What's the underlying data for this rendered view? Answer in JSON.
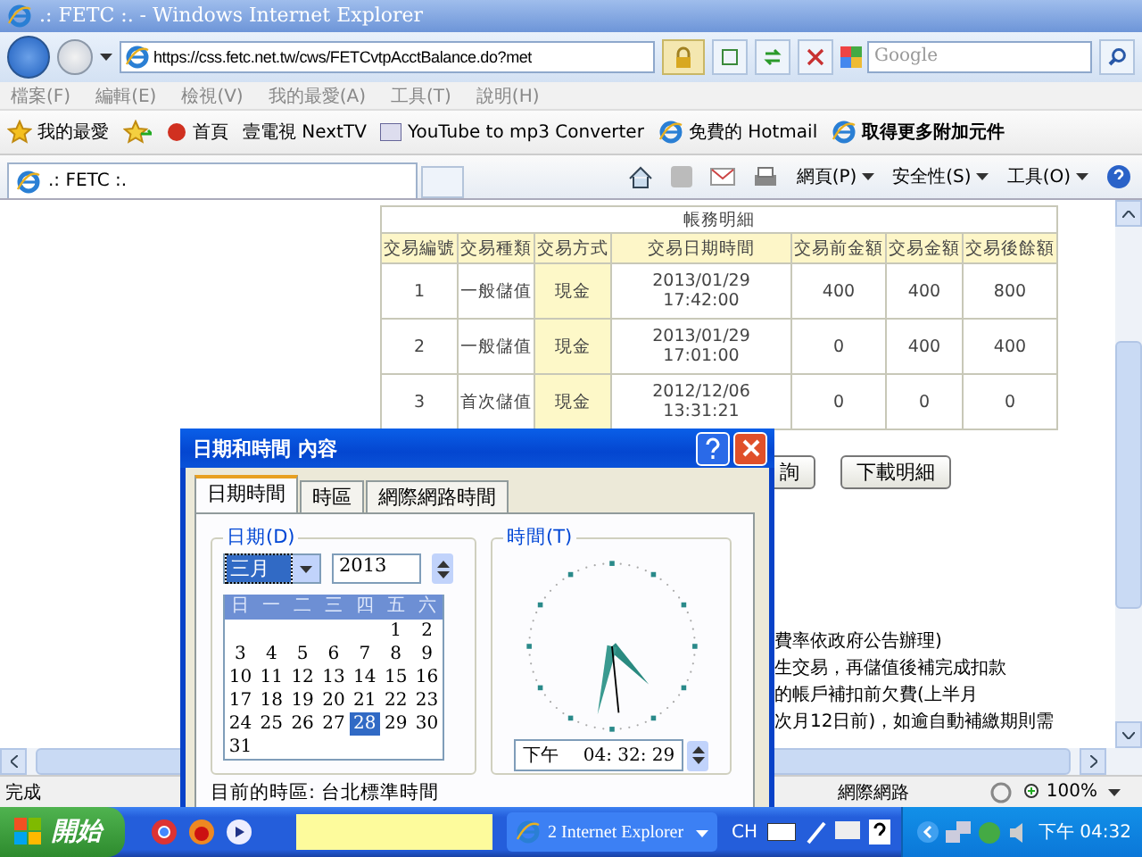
{
  "window": {
    "title": ".: FETC :. - Windows Internet Explorer"
  },
  "address_bar": {
    "url": "https://css.fetc.net.tw/cws/FETCvtpAcctBalance.do?met",
    "search_placeholder": "Google"
  },
  "menu": [
    "檔案(F)",
    "編輯(E)",
    "檢視(V)",
    "我的最愛(A)",
    "工具(T)",
    "說明(H)"
  ],
  "favorites": {
    "label": "我的最愛",
    "links": [
      "首頁",
      "壹電視 NextTV",
      "YouTube to mp3 Converter",
      "免費的 Hotmail",
      "取得更多附加元件"
    ]
  },
  "tabs": [
    {
      "label": ".: FETC :.",
      "selected": true
    }
  ],
  "command_bar": [
    "網頁(P)",
    "安全性(S)",
    "工具(O)"
  ],
  "page": {
    "table": {
      "caption": "帳務明細",
      "columns": [
        {
          "label": "交易編號",
          "highlight": false
        },
        {
          "label": "交易種類",
          "highlight": false
        },
        {
          "label": "交易方式",
          "highlight": true
        },
        {
          "label": "交易日期時間",
          "highlight": false
        },
        {
          "label": "交易前金額",
          "highlight": false
        },
        {
          "label": "交易金額",
          "highlight": false
        },
        {
          "label": "交易後餘額",
          "highlight": false
        }
      ],
      "rows": [
        [
          "1",
          "一般儲值",
          "現金",
          "2013/01/29 17:42:00",
          "400",
          "400",
          "800"
        ],
        [
          "2",
          "一般儲值",
          "現金",
          "2013/01/29 17:01:00",
          "0",
          "400",
          "400"
        ],
        [
          "3",
          "首次儲值",
          "現金",
          "2012/12/06 13:31:21",
          "0",
          "0",
          "0"
        ]
      ]
    },
    "buttons": [
      "詢",
      "下載明細"
    ],
    "notes": [
      "費率依政府公告辦理)",
      "生交易，再儲值後補完成扣款",
      "的帳戶補扣前欠費(上半月",
      "次月12日前)，如逾自動補繳期則需"
    ]
  },
  "status_bar": {
    "text": "完成",
    "zone": "網際網路",
    "zoom": "100%"
  },
  "dialog": {
    "title": "日期和時間 內容",
    "tabs": [
      {
        "label": "日期時間",
        "selected": true
      },
      {
        "label": "時區",
        "selected": false
      },
      {
        "label": "網際網路時間",
        "selected": false
      }
    ],
    "date_group": "日期(D)",
    "month": "三月",
    "year": "2013",
    "weekdays": [
      "日",
      "一",
      "二",
      "三",
      "四",
      "五",
      "六"
    ],
    "weeks": [
      [
        {
          "label": "1",
          "selected": false
        },
        {
          "label": "2",
          "selected": false
        }
      ],
      [
        {
          "label": "3",
          "selected": false
        },
        {
          "label": "4",
          "selected": false
        },
        {
          "label": "5",
          "selected": false
        },
        {
          "label": "6",
          "selected": false
        },
        {
          "label": "7",
          "selected": false
        },
        {
          "label": "8",
          "selected": false
        },
        {
          "label": "9",
          "selected": false
        }
      ],
      [
        {
          "label": "10",
          "selected": false
        },
        {
          "label": "11",
          "selected": false
        },
        {
          "label": "12",
          "selected": false
        },
        {
          "label": "13",
          "selected": false
        },
        {
          "label": "14",
          "selected": false
        },
        {
          "label": "15",
          "selected": false
        },
        {
          "label": "16",
          "selected": false
        }
      ],
      [
        {
          "label": "17",
          "selected": false
        },
        {
          "label": "18",
          "selected": false
        },
        {
          "label": "19",
          "selected": false
        },
        {
          "label": "20",
          "selected": false
        },
        {
          "label": "21",
          "selected": false
        },
        {
          "label": "22",
          "selected": false
        },
        {
          "label": "23",
          "selected": false
        }
      ],
      [
        {
          "label": "24",
          "selected": false
        },
        {
          "label": "25",
          "selected": false
        },
        {
          "label": "26",
          "selected": false
        },
        {
          "label": "27",
          "selected": false
        },
        {
          "label": "28",
          "selected": true
        },
        {
          "label": "29",
          "selected": false
        },
        {
          "label": "30",
          "selected": false
        }
      ],
      [
        {
          "label": "31",
          "selected": false
        }
      ]
    ],
    "time_group": "時間(T)",
    "ampm": "下午",
    "time": "04: 32: 29",
    "timezone": "目前的時區: 台北標準時間"
  },
  "taskbar": {
    "start": "開始",
    "window_button": "2 Internet Explorer",
    "language": "CH",
    "clock": "下午 04:32"
  }
}
